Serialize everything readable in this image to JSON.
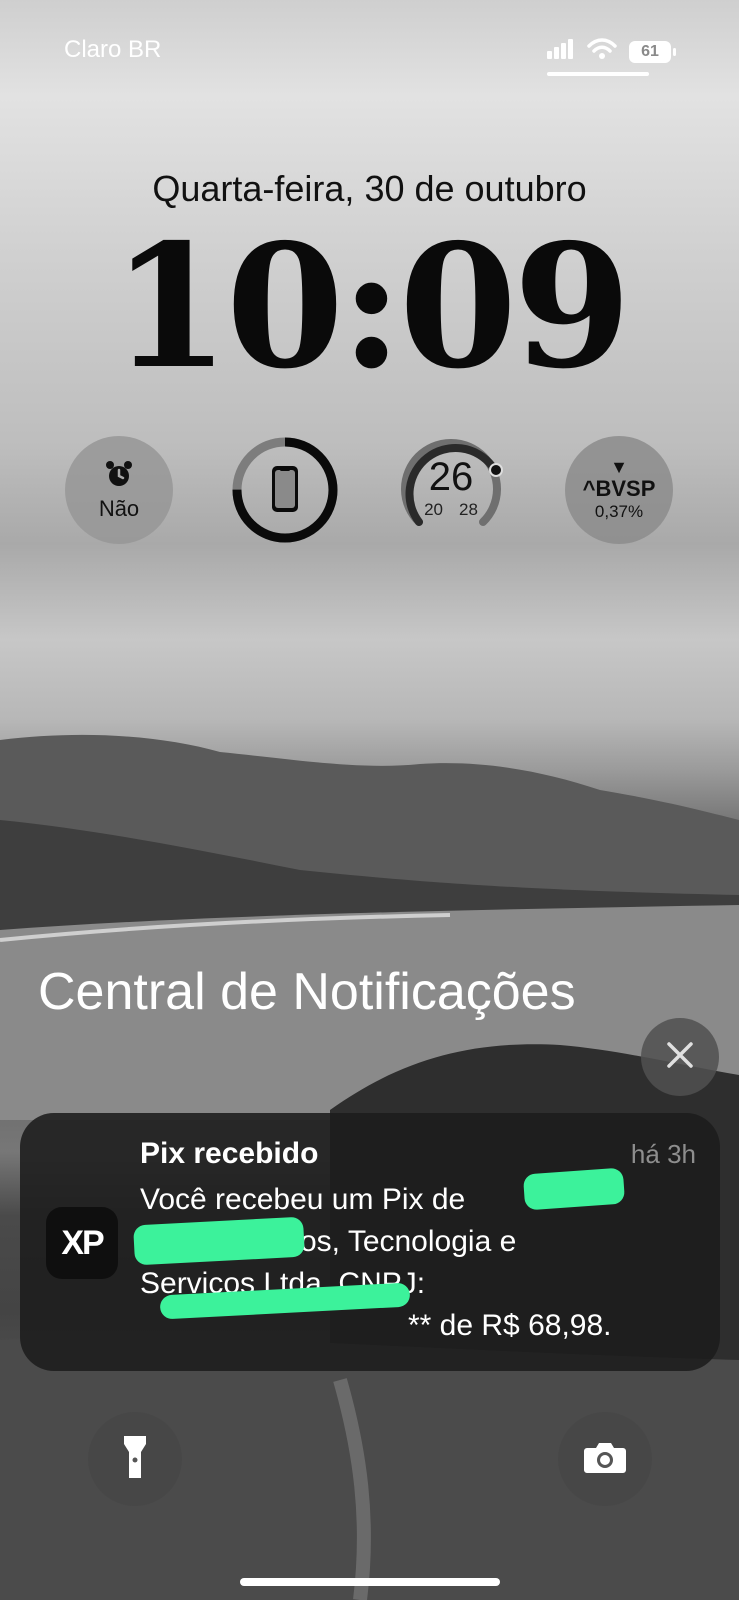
{
  "status_bar": {
    "carrier": "Claro BR",
    "battery": "61",
    "icons": [
      "signal-icon",
      "wifi-icon",
      "battery-icon"
    ]
  },
  "lock_screen": {
    "date": "Quarta-feira, 30 de outubro",
    "time": "10:09"
  },
  "widgets": {
    "alarm": {
      "icon": "alarm-clock-icon",
      "label": "Não"
    },
    "device_battery": {
      "icon": "phone-icon",
      "level": 0.75
    },
    "weather": {
      "current": "26",
      "low": "20",
      "high": "28"
    },
    "stock": {
      "direction": "▼",
      "symbol": "^BVSP",
      "change": "0,37%"
    }
  },
  "notification_center": {
    "title": "Central de Notificações",
    "close_icon": "close-icon"
  },
  "notification": {
    "app_icon_text": "XP",
    "title": "Pix recebido",
    "time": "há 3h",
    "body_line1": "Você recebeu um Pix de",
    "body_line2": "os, Tecnologia e",
    "body_line3": "Servicos Ltda, CNPJ:",
    "body_line4": "** de R$ 68,98."
  },
  "quick_actions": {
    "flashlight": "flashlight-icon",
    "camera": "camera-icon"
  },
  "colors": {
    "redaction": "#3cf29b",
    "notification_bg": "#1c1c1c"
  }
}
